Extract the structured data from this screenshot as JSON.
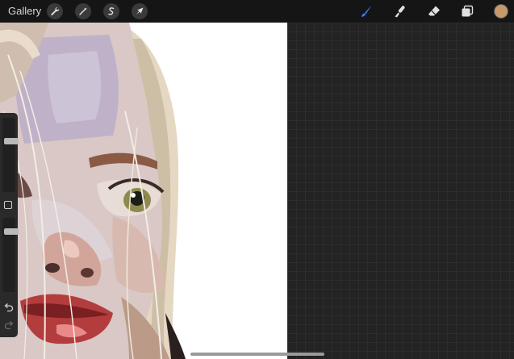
{
  "topbar": {
    "gallery_label": "Gallery",
    "left_tools": [
      "wrench-icon",
      "magic-wand-icon",
      "selection-icon",
      "transform-arrow-icon"
    ],
    "right_tools": [
      "brush-icon",
      "smudge-icon",
      "eraser-icon",
      "layers-icon"
    ],
    "active_tool": "brush-icon",
    "active_tool_color": "#3b7dff",
    "current_color": "#c49a6c"
  },
  "sidebar": {
    "brush_size_level": 0.3,
    "opacity_level": 0.15
  }
}
